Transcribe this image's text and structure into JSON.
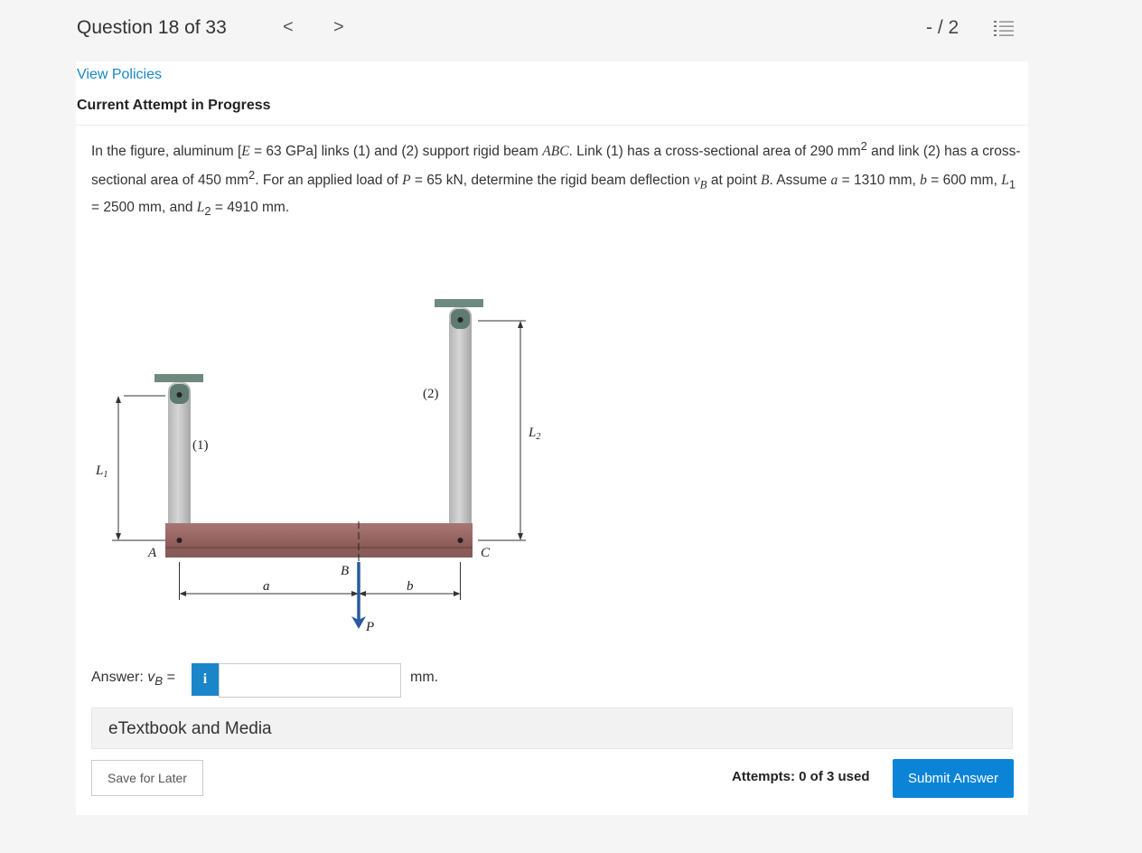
{
  "header": {
    "question_title": "Question 18 of 33",
    "prev_icon": "chevron-left-icon",
    "prev_glyph": "<",
    "next_icon": "chevron-right-icon",
    "next_glyph": ">",
    "score": "- / 2",
    "list_icon": "list-icon"
  },
  "view_policies": "View Policies",
  "attempt_status": "Current Attempt in Progress",
  "prompt": {
    "p1": "In the figure, aluminum [",
    "E": "E",
    "p2": " = 63 GPa] links (1) and (2) support rigid beam ",
    "ABC": "ABC",
    "p3": ". Link (1) has a cross-sectional area of 290 mm",
    "sup1": "2",
    "p4": " and link (2) has a cross-sectional area of 450 mm",
    "sup2": "2",
    "p5": ". For an applied load of ",
    "P": "P",
    "p6": " = 65 kN, determine the rigid beam deflection ",
    "vB": "v",
    "vB_sub": "B",
    "p7": " at point ",
    "B": "B",
    "p8": ". Assume ",
    "a": "a",
    "p9": " = 1310 mm, ",
    "b": "b",
    "p10": " = 600 mm, ",
    "L1": "L",
    "L1_sub": "1",
    "p11": " = 2500 mm, and ",
    "L2": "L",
    "L2_sub": "2",
    "p12": " = 4910 mm."
  },
  "figure_labels": {
    "link1": "(1)",
    "link2": "(2)",
    "L1": "L",
    "L1_sub": "1",
    "L2": "L",
    "L2_sub": "2",
    "A": "A",
    "B": "B",
    "C": "C",
    "a": "a",
    "b": "b",
    "P": "P"
  },
  "answer": {
    "label": "Answer: ",
    "var": "v",
    "var_sub": "B",
    "eq": " =",
    "info_glyph": "i",
    "info_icon": "info-icon",
    "value": "",
    "unit": "mm."
  },
  "etextbook": "eTextbook and Media",
  "save_label": "Save for Later",
  "attempts": "Attempts: 0 of 3 used",
  "submit_label": "Submit Answer",
  "colors": {
    "link_blue": "#1a86c9",
    "submit_blue": "#0b84d8",
    "beam": "#9b6461",
    "support": "#6e8a7e",
    "link_gray": "#c2c2c2",
    "arrow": "#2a5aa0"
  }
}
